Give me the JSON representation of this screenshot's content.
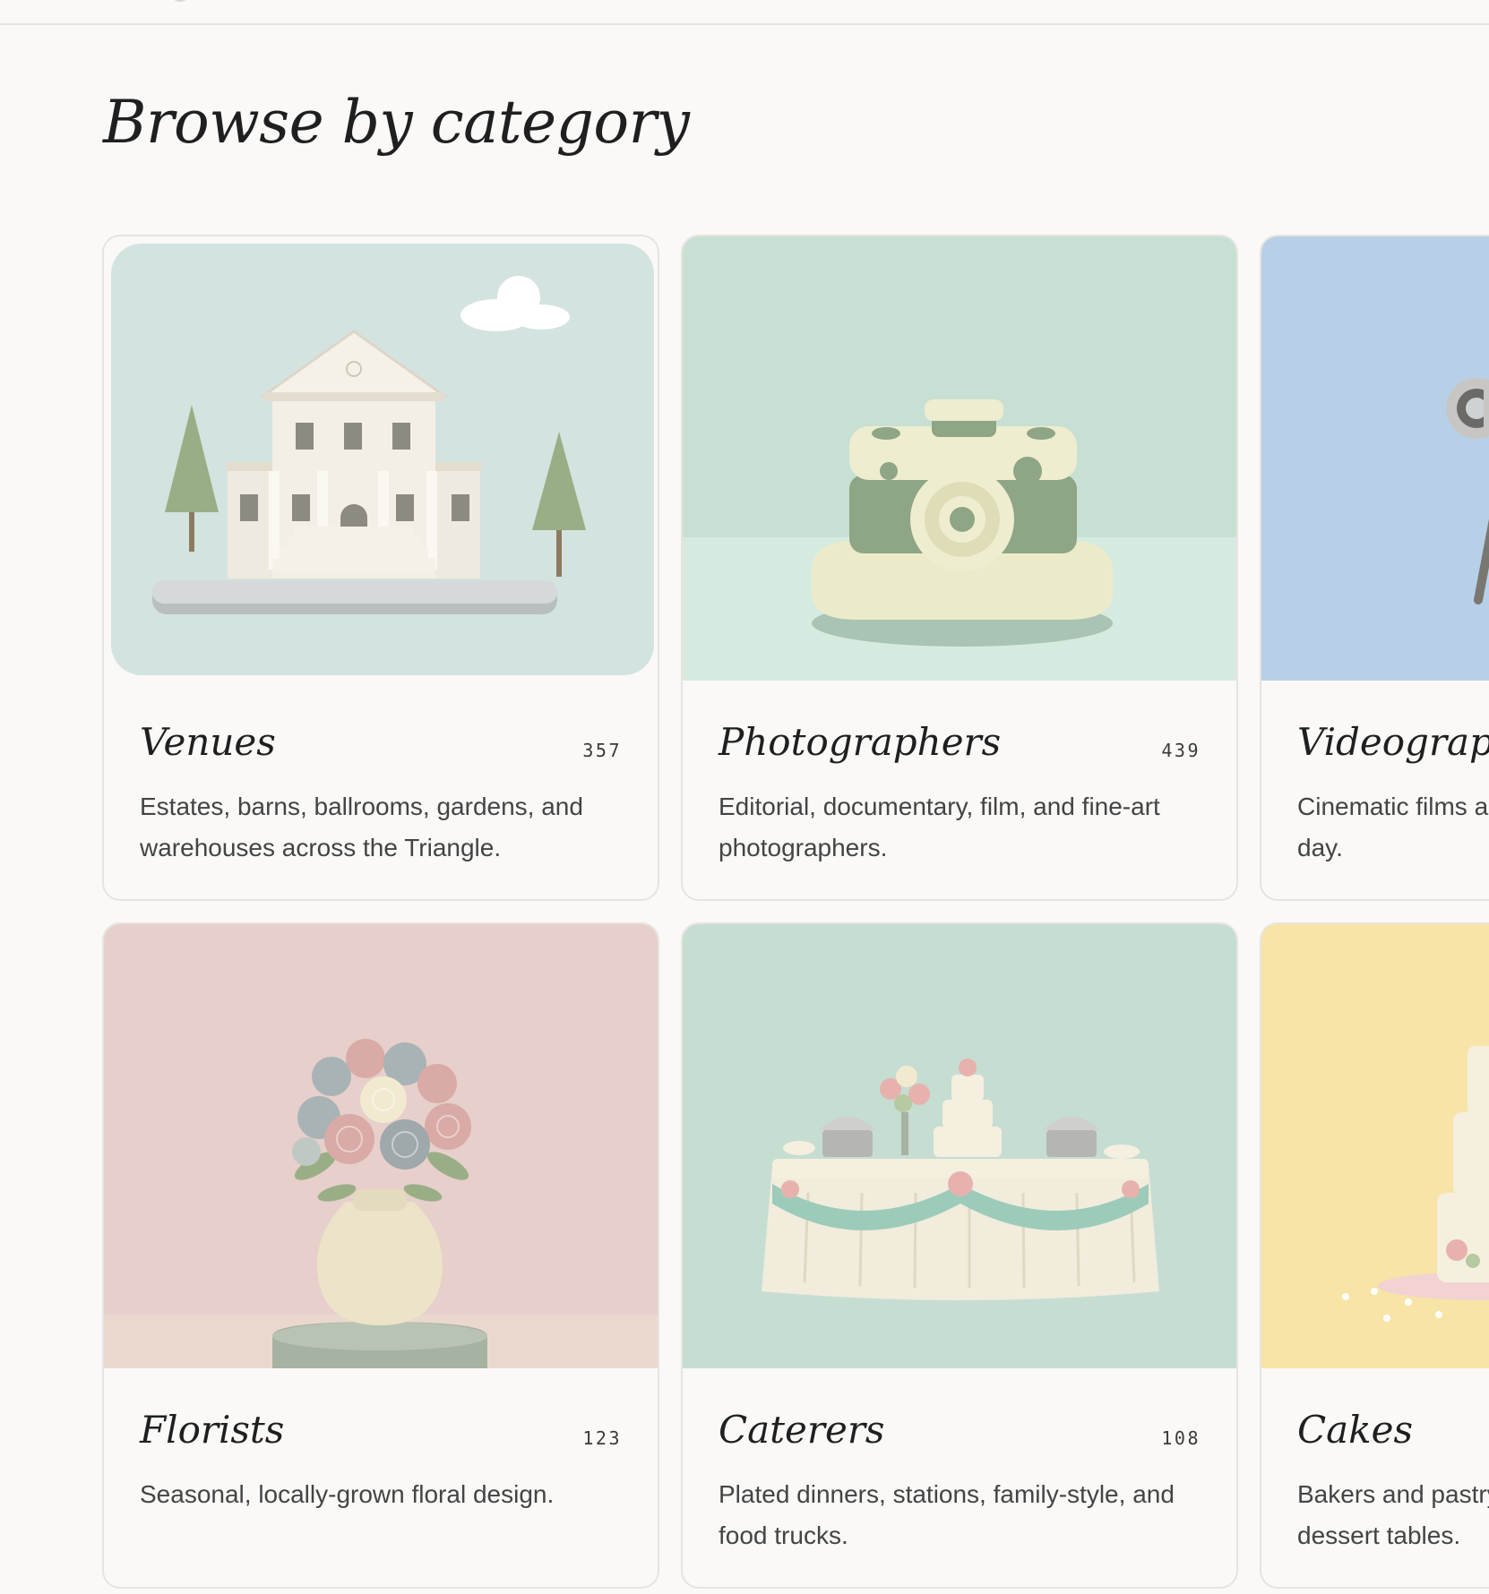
{
  "page": {
    "title": "Browse by category"
  },
  "colors": {
    "background": "#faf9f7",
    "card_border": "#e7e4df",
    "title_text": "#1f1f1f",
    "body_text": "#444444"
  },
  "categories": [
    {
      "name": "Venues",
      "count": "357",
      "description": "Estates, barns, ballrooms, gardens, and warehouses across the Triangle.",
      "image": "venue-building-illustration",
      "bg_color": "#d3e3e0"
    },
    {
      "name": "Photographers",
      "count": "439",
      "description": "Editorial, documentary, film, and fine-art photographers.",
      "image": "clay-camera-illustration",
      "bg_color": "#c8e0d3"
    },
    {
      "name": "Videographers",
      "count": "",
      "description": "Cinematic films and highlight reels of your day.",
      "image": "clay-video-camera-illustration",
      "bg_color": "#b7d0e7"
    },
    {
      "name": "Florists",
      "count": "123",
      "description": "Seasonal, locally-grown floral design.",
      "image": "clay-flower-vase-illustration",
      "bg_color": "#e7cfcb"
    },
    {
      "name": "Caterers",
      "count": "108",
      "description": "Plated dinners, stations, family-style, and food trucks.",
      "image": "clay-buffet-table-illustration",
      "bg_color": "#c6ddd2"
    },
    {
      "name": "Cakes",
      "count": "",
      "description": "Bakers and pastry artists for cakes and dessert tables.",
      "image": "clay-wedding-cake-illustration",
      "bg_color": "#f7e4a6"
    }
  ]
}
